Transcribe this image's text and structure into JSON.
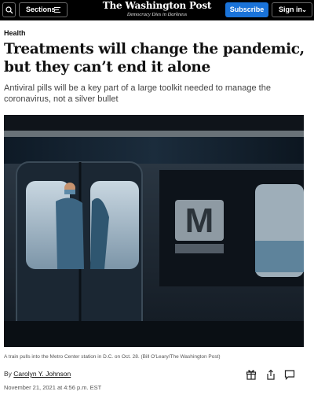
{
  "header": {
    "sections_label": "Sections",
    "logo": "The Washington Post",
    "tagline": "Democracy Dies in Darkness",
    "subscribe_label": "Subscribe",
    "signin_label": "Sign in"
  },
  "article": {
    "kicker": "Health",
    "headline": "Treatments will change the pandemic, but they can’t end it alone",
    "subhead": "Antiviral pills will be a key part of a large toolkit needed to manage the coronavirus, not a silver bullet",
    "photo_sign_text": "M",
    "caption": "A train pulls into the Metro Center station in D.C. on Oct. 28. (Bill O'Leary/The Washington Post)",
    "byline_prefix": "By",
    "author": "Carolyn Y. Johnson",
    "timestamp": "November 21, 2021 at 4:56 p.m. EST"
  },
  "icons": {
    "search": "search-icon",
    "menu": "menu-icon",
    "chevron": "chevron-down-icon",
    "gift": "gift-icon",
    "share": "share-icon",
    "comment": "comment-icon"
  },
  "colors": {
    "header_bg": "#000000",
    "subscribe_bg": "#1a73d9",
    "text": "#111111"
  }
}
